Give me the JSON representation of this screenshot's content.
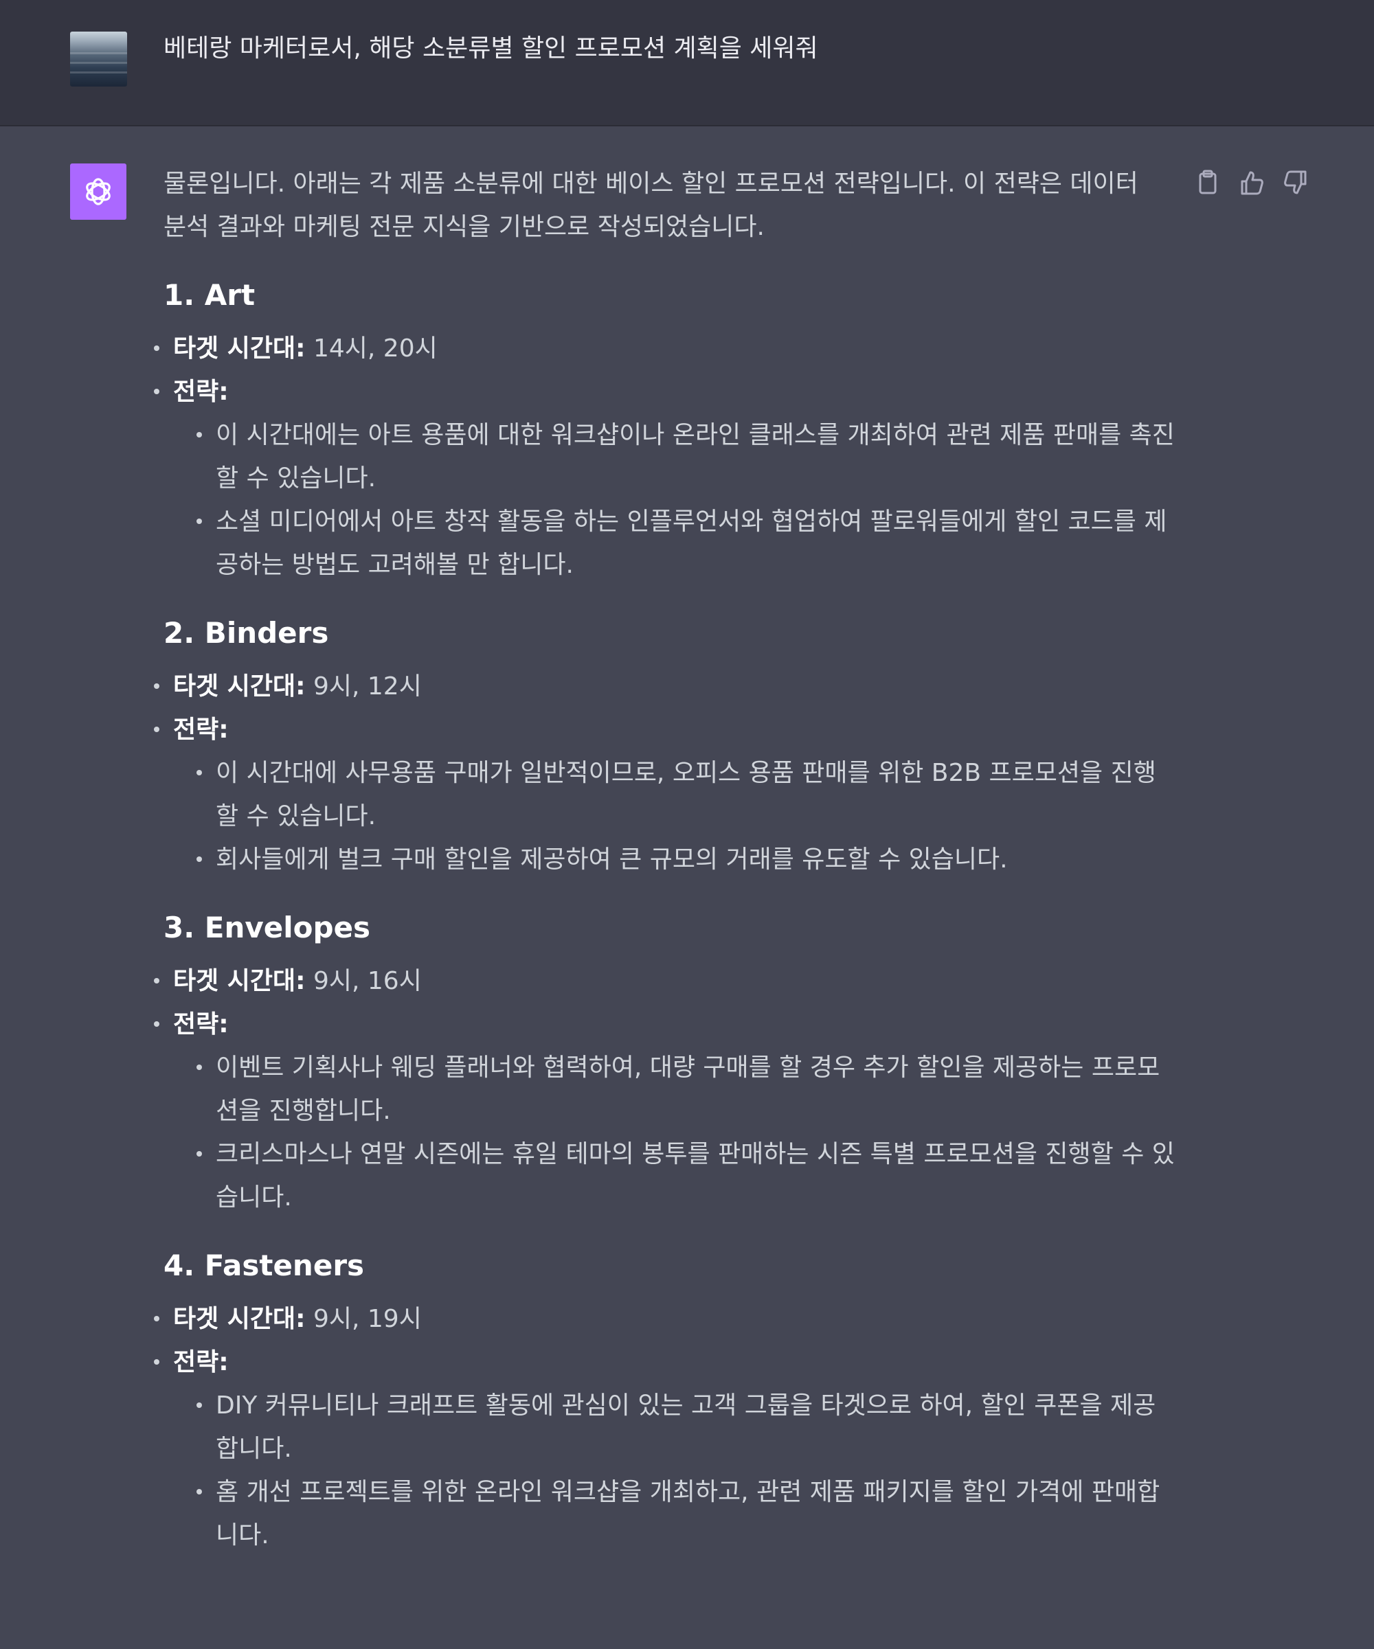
{
  "user_message": {
    "text": "베테랑 마케터로서, 해당 소분류별 할인 프로모션 계획을 세워줘"
  },
  "assistant_message": {
    "intro": "물론입니다. 아래는 각 제품 소분류에 대한 베이스 할인 프로모션 전략입니다. 이 전략은 데이터 분석 결과와 마케팅 전문 지식을 기반으로 작성되었습니다.",
    "sections": [
      {
        "title": "1. Art",
        "target_label": "타겟 시간대:",
        "target_value": " 14시, 20시",
        "strategy_label": "전략:",
        "strategies": [
          "이 시간대에는 아트 용품에 대한 워크샵이나 온라인 클래스를 개최하여 관련 제품 판매를 촉진할 수 있습니다.",
          "소셜 미디어에서 아트 창작 활동을 하는 인플루언서와 협업하여 팔로워들에게 할인 코드를 제공하는 방법도 고려해볼 만 합니다."
        ]
      },
      {
        "title": "2. Binders",
        "target_label": "타겟 시간대:",
        "target_value": " 9시, 12시",
        "strategy_label": "전략:",
        "strategies": [
          "이 시간대에 사무용품 구매가 일반적이므로, 오피스 용품 판매를 위한 B2B 프로모션을 진행할 수 있습니다.",
          "회사들에게 벌크 구매 할인을 제공하여 큰 규모의 거래를 유도할 수 있습니다."
        ]
      },
      {
        "title": "3. Envelopes",
        "target_label": "타겟 시간대:",
        "target_value": " 9시, 16시",
        "strategy_label": "전략:",
        "strategies": [
          "이벤트 기획사나 웨딩 플래너와 협력하여, 대량 구매를 할 경우 추가 할인을 제공하는 프로모션을 진행합니다.",
          "크리스마스나 연말 시즌에는 휴일 테마의 봉투를 판매하는 시즌 특별 프로모션을 진행할 수 있습니다."
        ]
      },
      {
        "title": "4. Fasteners",
        "target_label": "타겟 시간대:",
        "target_value": " 9시, 19시",
        "strategy_label": "전략:",
        "strategies": [
          "DIY 커뮤니티나 크래프트 활동에 관심이 있는 고객 그룹을 타겟으로 하여, 할인 쿠폰을 제공합니다.",
          "홈 개선 프로젝트를 위한 온라인 워크샵을 개최하고, 관련 제품 패키지를 할인 가격에 판매합니다."
        ]
      }
    ]
  },
  "icons": {
    "copy": "clipboard-icon",
    "like": "thumbs-up-icon",
    "dislike": "thumbs-down-icon",
    "assistant": "openai-logo-icon"
  },
  "colors": {
    "user_bg": "#343541",
    "assistant_bg": "#444654",
    "assistant_avatar": "#ab68ff",
    "text": "#d1d5db"
  }
}
